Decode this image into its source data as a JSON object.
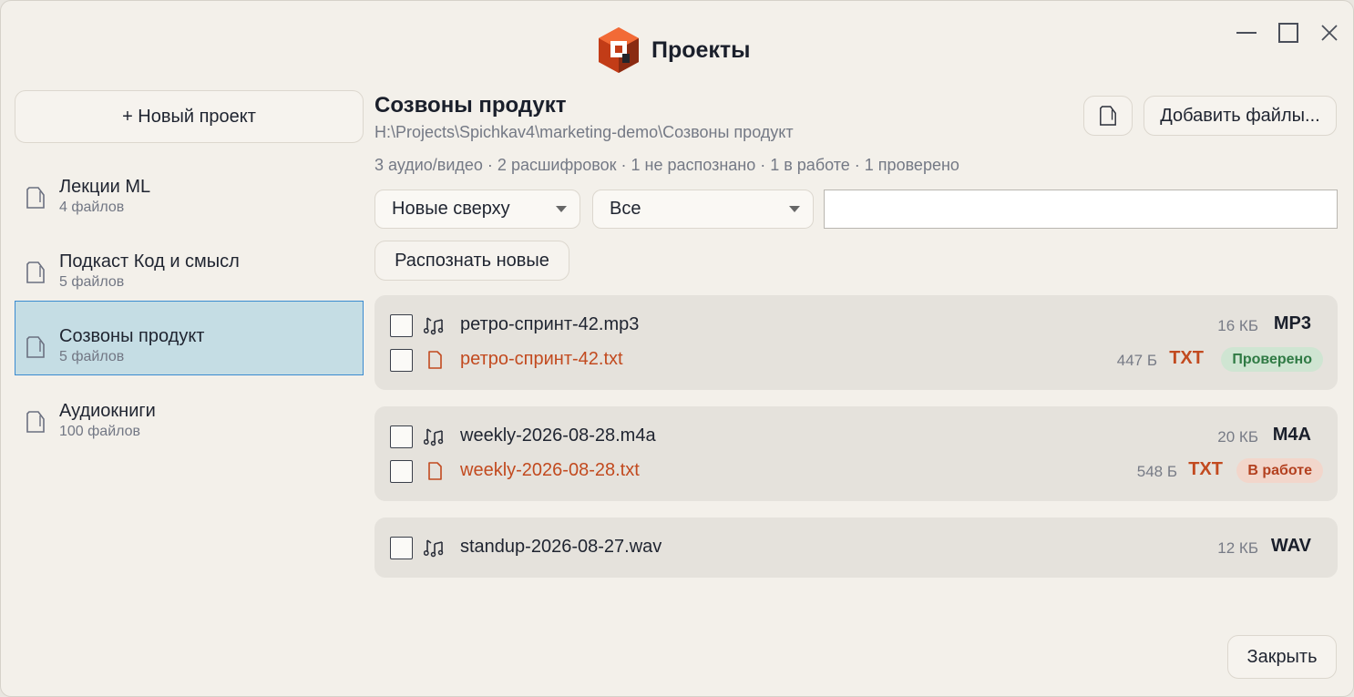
{
  "app": {
    "title": "Проекты"
  },
  "colors": {
    "accent": "#3a8bd0",
    "txt_orange": "#c24a1f",
    "verified_green": "#2f7a44",
    "inwork_red": "#b3401f",
    "logo_orange": "#e0451c"
  },
  "window_controls": {
    "minimize": "minimize-icon",
    "maximize": "maximize-icon",
    "close": "close-icon"
  },
  "sidebar": {
    "new_project_label": "+ Новый проект",
    "projects": [
      {
        "name": "Лекции ML",
        "count": "4 файлов",
        "selected": false
      },
      {
        "name": "Подкаст Код и смысл",
        "count": "5 файлов",
        "selected": false
      },
      {
        "name": "Созвоны продукт",
        "count": "5 файлов",
        "selected": true
      },
      {
        "name": "Аудиокниги",
        "count": "100 файлов",
        "selected": false
      }
    ]
  },
  "main": {
    "title": "Созвоны продукт",
    "path": "H:\\Projects\\Spichkav4\\marketing-demo\\Созвоны продукт",
    "stats": "3 аудио/видео · 2 расшифровок · 1 не распознано · 1 в работе · 1 проверено",
    "open_folder_icon": "folder-icon",
    "add_files_label": "Добавить файлы...",
    "sort_select": "Новые сверху",
    "filter_select": "Все",
    "search_value": "",
    "recognize_label": "Распознать новые",
    "groups": [
      {
        "media": {
          "name": "ретро-спринт-42.mp3",
          "size": "16 КБ",
          "type": "MP3"
        },
        "transcript": {
          "name": "ретро-спринт-42.txt",
          "size": "447 Б",
          "type": "TXT",
          "status": "Проверено",
          "status_kind": "ok"
        }
      },
      {
        "media": {
          "name": "weekly-2026-08-28.m4a",
          "size": "20 КБ",
          "type": "M4A"
        },
        "transcript": {
          "name": "weekly-2026-08-28.txt",
          "size": "548 Б",
          "type": "TXT",
          "status": "В работе",
          "status_kind": "work"
        }
      },
      {
        "media": {
          "name": "standup-2026-08-27.wav",
          "size": "12 КБ",
          "type": "WAV"
        }
      }
    ]
  },
  "footer": {
    "close_label": "Закрыть"
  }
}
